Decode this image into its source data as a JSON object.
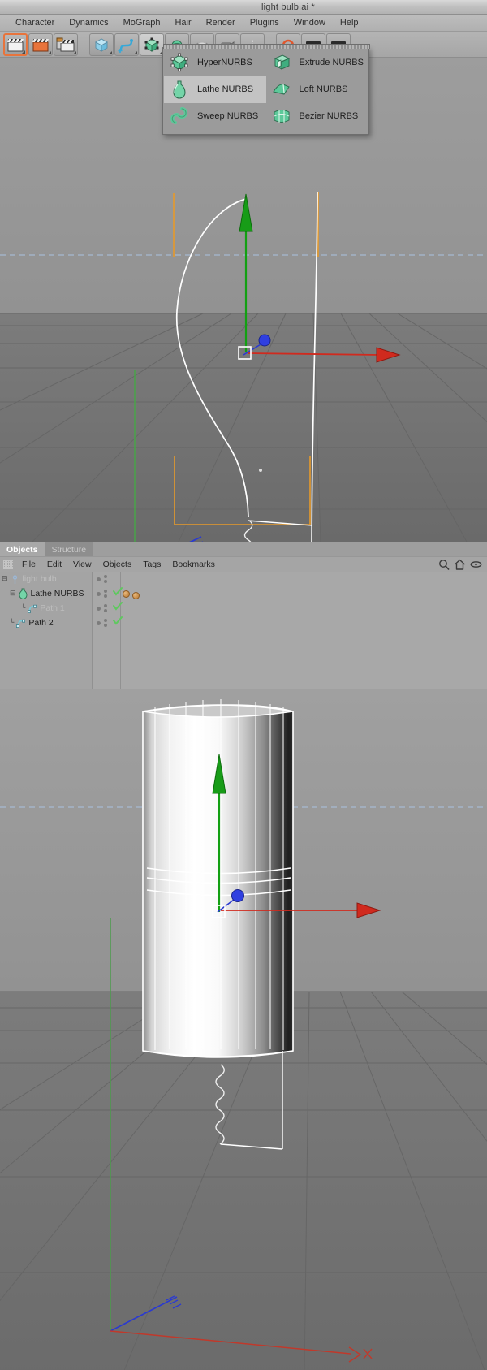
{
  "titlebar": {
    "document_title": "light bulb.ai *"
  },
  "menubar": {
    "items": [
      {
        "label": "Character"
      },
      {
        "label": "Dynamics"
      },
      {
        "label": "MoGraph"
      },
      {
        "label": "Hair"
      },
      {
        "label": "Render"
      },
      {
        "label": "Plugins"
      },
      {
        "label": "Window"
      },
      {
        "label": "Help"
      }
    ]
  },
  "toolbar": {
    "buttons": [
      {
        "name": "undo-button",
        "icon": "clapperboard-white-icon",
        "selected": true
      },
      {
        "name": "redo-button",
        "icon": "clapperboard-orange-icon",
        "selected": false
      },
      {
        "name": "render-region-button",
        "icon": "clapperboard-stack-icon",
        "selected": false
      },
      {
        "name": "primitive-cube-button",
        "icon": "blue-cube-icon",
        "selected": false
      },
      {
        "name": "spline-button",
        "icon": "spline-curve-icon",
        "selected": false
      },
      {
        "name": "nurbs-button",
        "icon": "green-nurbs-cube-icon",
        "selected": false,
        "active": true
      },
      {
        "name": "modeling-button",
        "icon": "green-sphere-icon",
        "selected": false
      },
      {
        "name": "deformer-button",
        "icon": "deformer-icon",
        "selected": false
      },
      {
        "name": "camera-button",
        "icon": "camera-icon",
        "selected": false
      },
      {
        "name": "light-button",
        "icon": "light-icon",
        "selected": false
      },
      {
        "name": "material-button",
        "icon": "render-settings-icon",
        "selected": false
      },
      {
        "name": "layout-button",
        "icon": "layout-icon",
        "selected": false
      }
    ]
  },
  "nurbs_palette": {
    "visible": true,
    "items": [
      {
        "label": "HyperNURBS",
        "icon": "hypernurbs-cube-icon",
        "highlighted": false
      },
      {
        "label": "Extrude NURBS",
        "icon": "extrude-nurbs-icon",
        "highlighted": false
      },
      {
        "label": "Lathe NURBS",
        "icon": "lathe-nurbs-vase-icon",
        "highlighted": true
      },
      {
        "label": "Loft NURBS",
        "icon": "loft-nurbs-icon",
        "highlighted": false
      },
      {
        "label": "Sweep NURBS",
        "icon": "sweep-nurbs-icon",
        "highlighted": false
      },
      {
        "label": "Bezier NURBS",
        "icon": "bezier-nurbs-icon",
        "highlighted": false
      }
    ]
  },
  "object_manager": {
    "tabs": [
      {
        "label": "Objects",
        "active": true
      },
      {
        "label": "Structure",
        "active": false
      }
    ],
    "menus": [
      {
        "label": "File"
      },
      {
        "label": "Edit"
      },
      {
        "label": "View"
      },
      {
        "label": "Objects"
      },
      {
        "label": "Tags"
      },
      {
        "label": "Bookmarks"
      }
    ],
    "header_icons": [
      {
        "name": "search-icon"
      },
      {
        "name": "home-icon"
      },
      {
        "name": "eye-icon"
      }
    ],
    "tree": [
      {
        "label": "light bulb",
        "icon": "null-object-icon",
        "depth": 0,
        "expander": "minus",
        "dimmed": true,
        "tags": []
      },
      {
        "label": "Lathe NURBS",
        "icon": "lathe-nurbs-vase-icon",
        "depth": 1,
        "expander": "minus",
        "dimmed": false,
        "tags": [
          "material",
          "material"
        ]
      },
      {
        "label": "Path 1",
        "icon": "spline-path-icon",
        "depth": 2,
        "expander": "none",
        "dimmed": true,
        "tags": []
      },
      {
        "label": "Path 2",
        "icon": "spline-path-icon",
        "depth": 1,
        "expander": "none",
        "dimmed": false,
        "tags": []
      }
    ]
  },
  "viewports": {
    "top": {
      "name": "perspective-viewport-top",
      "contents": "light bulb profile spline with lathe axis gizmo"
    },
    "bottom": {
      "name": "perspective-viewport-bottom",
      "contents": "lathed cylinder result with axis gizmo"
    }
  },
  "colors": {
    "accent_orange": "#e8743c",
    "nurbs_green": "#5dc99a",
    "axis_y_green": "#13a013",
    "axis_x_red": "#d02a1e",
    "axis_z_blue": "#2a3ad0",
    "spline_orange": "#e79a2a",
    "horizon_blue": "#a9c2e0",
    "check_green": "#5ec85e",
    "panel_gray": "#a8a8a8"
  }
}
